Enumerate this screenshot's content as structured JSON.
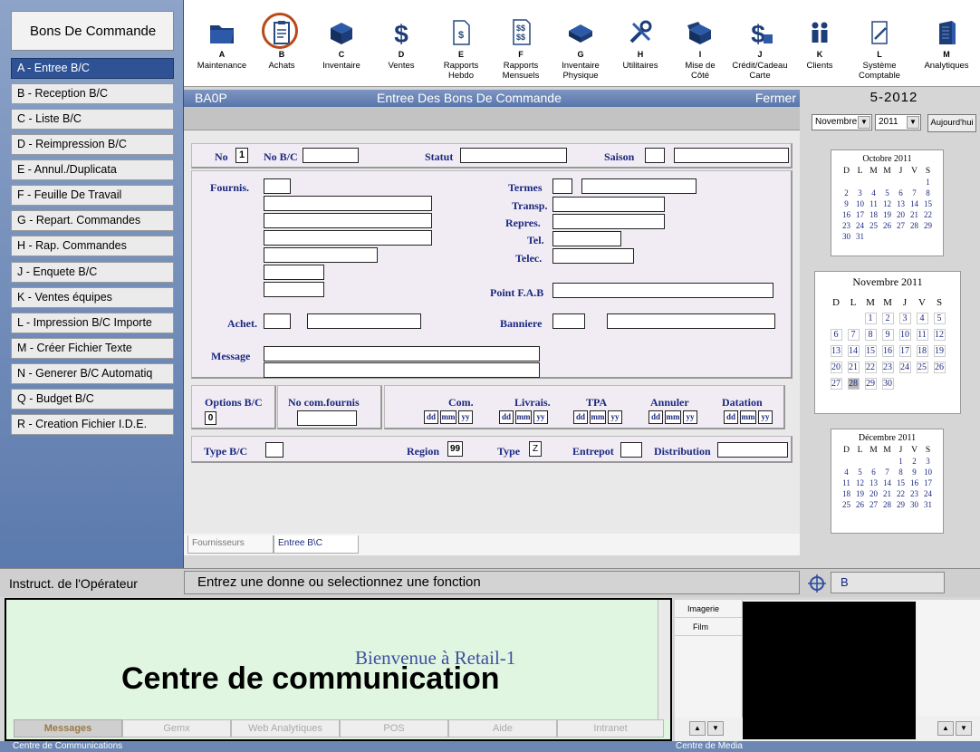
{
  "sidebar": {
    "title": "Bons De Commande",
    "items": [
      {
        "label": "A - Entree B/C"
      },
      {
        "label": "B - Reception B/C"
      },
      {
        "label": "C - Liste B/C"
      },
      {
        "label": "D - Reimpression B/C"
      },
      {
        "label": "E - Annul./Duplicata"
      },
      {
        "label": "F - Feuille De Travail"
      },
      {
        "label": "G - Repart. Commandes"
      },
      {
        "label": "H - Rap. Commandes"
      },
      {
        "label": "J - Enquete B/C"
      },
      {
        "label": "K - Ventes équipes"
      },
      {
        "label": "L - Impression B/C Importe"
      },
      {
        "label": "M - Créer Fichier Texte"
      },
      {
        "label": "N - Generer B/C Automatiq"
      },
      {
        "label": "Q - Budget B/C"
      },
      {
        "label": "R - Creation Fichier I.D.E."
      }
    ]
  },
  "toolbar": [
    {
      "key": "A",
      "label1": "Maintenance",
      "label2": "",
      "icon": "folder-icon"
    },
    {
      "key": "B",
      "label1": "Achats",
      "label2": "",
      "icon": "clipboard-icon"
    },
    {
      "key": "C",
      "label1": "Inventaire",
      "label2": "",
      "icon": "box-icon"
    },
    {
      "key": "D",
      "label1": "Ventes",
      "label2": "",
      "icon": "dollar-icon"
    },
    {
      "key": "E",
      "label1": "Rapports",
      "label2": "Hebdo",
      "icon": "report-icon"
    },
    {
      "key": "F",
      "label1": "Rapports",
      "label2": "Mensuels",
      "icon": "report-stack-icon"
    },
    {
      "key": "G",
      "label1": "Inventaire",
      "label2": "Physique",
      "icon": "cube-icon"
    },
    {
      "key": "H",
      "label1": "Utilitaires",
      "label2": "",
      "icon": "tools-icon"
    },
    {
      "key": "I",
      "label1": "Mise de",
      "label2": "Côté",
      "icon": "open-box-icon"
    },
    {
      "key": "J",
      "label1": "Crédit/Cadeau",
      "label2": "Carte",
      "icon": "dollar-card-icon"
    },
    {
      "key": "K",
      "label1": "Clients",
      "label2": "",
      "icon": "people-icon"
    },
    {
      "key": "L",
      "label1": "Système",
      "label2": "Comptable",
      "icon": "document-pen-icon"
    },
    {
      "key": "M",
      "label1": "Analytiques",
      "label2": "",
      "icon": "building-icon"
    }
  ],
  "window": {
    "code": "BA0P",
    "title": "Entree Des Bons De Commande",
    "close": "Fermer"
  },
  "form": {
    "no": "No",
    "no_value": "1",
    "no_bc": "No B/C",
    "statut": "Statut",
    "saison": "Saison",
    "fournis": "Fournis.",
    "termes": "Termes",
    "transp": "Transp.",
    "repres": "Repres.",
    "tel": "Tel.",
    "telec": "Telec.",
    "point_fab": "Point F.A.B",
    "achet": "Achet.",
    "banniere": "Banniere",
    "message": "Message",
    "options": "Options B/C",
    "options_value": "0",
    "no_com_fournis": "No com.fournis",
    "com": "Com.",
    "livrais": "Livrais.",
    "tpa": "TPA",
    "annuler": "Annuler",
    "datation": "Datation",
    "dd": "dd",
    "mm": "mm",
    "yy": "yy",
    "type_bc": "Type B/C",
    "region": "Region",
    "region_value": "99",
    "type": "Type",
    "type_value": "Z",
    "entrepot": "Entrepot",
    "distribution": "Distribution"
  },
  "bottom_tabs": [
    "Fournisseurs",
    "Entree B\\C"
  ],
  "right": {
    "date": "5-2012",
    "month_select": "Novembre",
    "year_select": "2011",
    "today_button": "Aujourd'hui",
    "weekdays": [
      "D",
      "L",
      "M",
      "M",
      "J",
      "V",
      "S"
    ],
    "calendars": [
      {
        "title": "Octobre 2011",
        "weeks": [
          [
            "",
            "",
            "",
            "",
            "",
            "",
            "1"
          ],
          [
            "2",
            "3",
            "4",
            "5",
            "6",
            "7",
            "8"
          ],
          [
            "9",
            "10",
            "11",
            "12",
            "13",
            "14",
            "15"
          ],
          [
            "16",
            "17",
            "18",
            "19",
            "20",
            "21",
            "22"
          ],
          [
            "23",
            "24",
            "25",
            "26",
            "27",
            "28",
            "29"
          ],
          [
            "30",
            "31",
            "",
            "",
            "",
            "",
            ""
          ]
        ]
      },
      {
        "title": "Novembre 2011",
        "weeks": [
          [
            "",
            "",
            "1",
            "2",
            "3",
            "4",
            "5"
          ],
          [
            "6",
            "7",
            "8",
            "9",
            "10",
            "11",
            "12"
          ],
          [
            "13",
            "14",
            "15",
            "16",
            "17",
            "18",
            "19"
          ],
          [
            "20",
            "21",
            "22",
            "23",
            "24",
            "25",
            "26"
          ],
          [
            "27",
            "28",
            "29",
            "30",
            "",
            "",
            ""
          ]
        ]
      },
      {
        "title": "Décembre 2011",
        "weeks": [
          [
            "",
            "",
            "",
            "",
            "1",
            "2",
            "3"
          ],
          [
            "4",
            "5",
            "6",
            "7",
            "8",
            "9",
            "10"
          ],
          [
            "11",
            "12",
            "13",
            "14",
            "15",
            "16",
            "17"
          ],
          [
            "18",
            "19",
            "20",
            "21",
            "22",
            "23",
            "24"
          ],
          [
            "25",
            "26",
            "27",
            "28",
            "29",
            "30",
            "31"
          ]
        ]
      }
    ],
    "selected_day": "28"
  },
  "status": {
    "label": "Instruct. de l'Opérateur",
    "message": "Entrez une donne ou selectionnez une fonction",
    "field": "B"
  },
  "comm": {
    "welcome": "Bienvenue à Retail-1",
    "overlay": "Centre de communication",
    "tabs": [
      "Messages",
      "Gemx",
      "Web Analytiques",
      "POS",
      "Aide",
      "Intranet"
    ]
  },
  "media": {
    "items": [
      "Imagerie",
      "Film"
    ]
  },
  "footer": {
    "left": "Centre de Communications",
    "right": "Centre de Media"
  }
}
